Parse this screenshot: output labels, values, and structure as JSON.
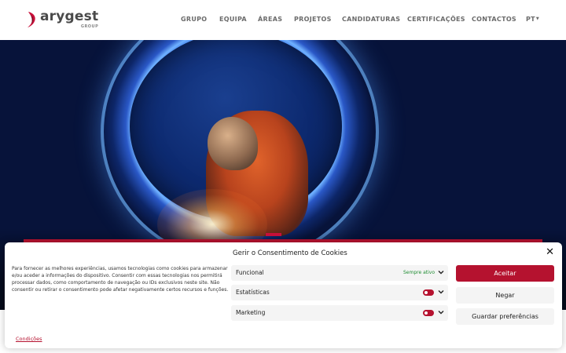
{
  "header": {
    "logo": {
      "name": "arygest",
      "subtitle": "GROUP"
    },
    "nav": [
      "GRUPO",
      "EQUIPA",
      "ÁREAS",
      "PROJETOS",
      "CANDIDATURAS",
      "CERTIFICAÇÕES",
      "CONTACTOS"
    ],
    "language": "PT"
  },
  "colors": {
    "accent": "#b5122f",
    "always_active": "#1e8c31"
  },
  "cookie": {
    "title": "Gerir o Consentimento de Cookies",
    "description": "Para fornecer as melhores experiências, usamos tecnologias como cookies para armazenar e/ou aceder a informações do dispositivo. Consentir com essas tecnologias nos permitirá processar dados, como comportamento de navegação ou IDs exclusivos neste site. Não consentir ou retirar o consentimento pode afetar negativamente certos recursos e funções.",
    "categories": [
      {
        "label": "Funcional",
        "status": "Sempre ativo"
      },
      {
        "label": "Estatísticas",
        "enabled": false
      },
      {
        "label": "Marketing",
        "enabled": false
      }
    ],
    "buttons": {
      "accept": "Aceitar",
      "deny": "Negar",
      "save": "Guardar preferências"
    },
    "link": "Condições"
  }
}
